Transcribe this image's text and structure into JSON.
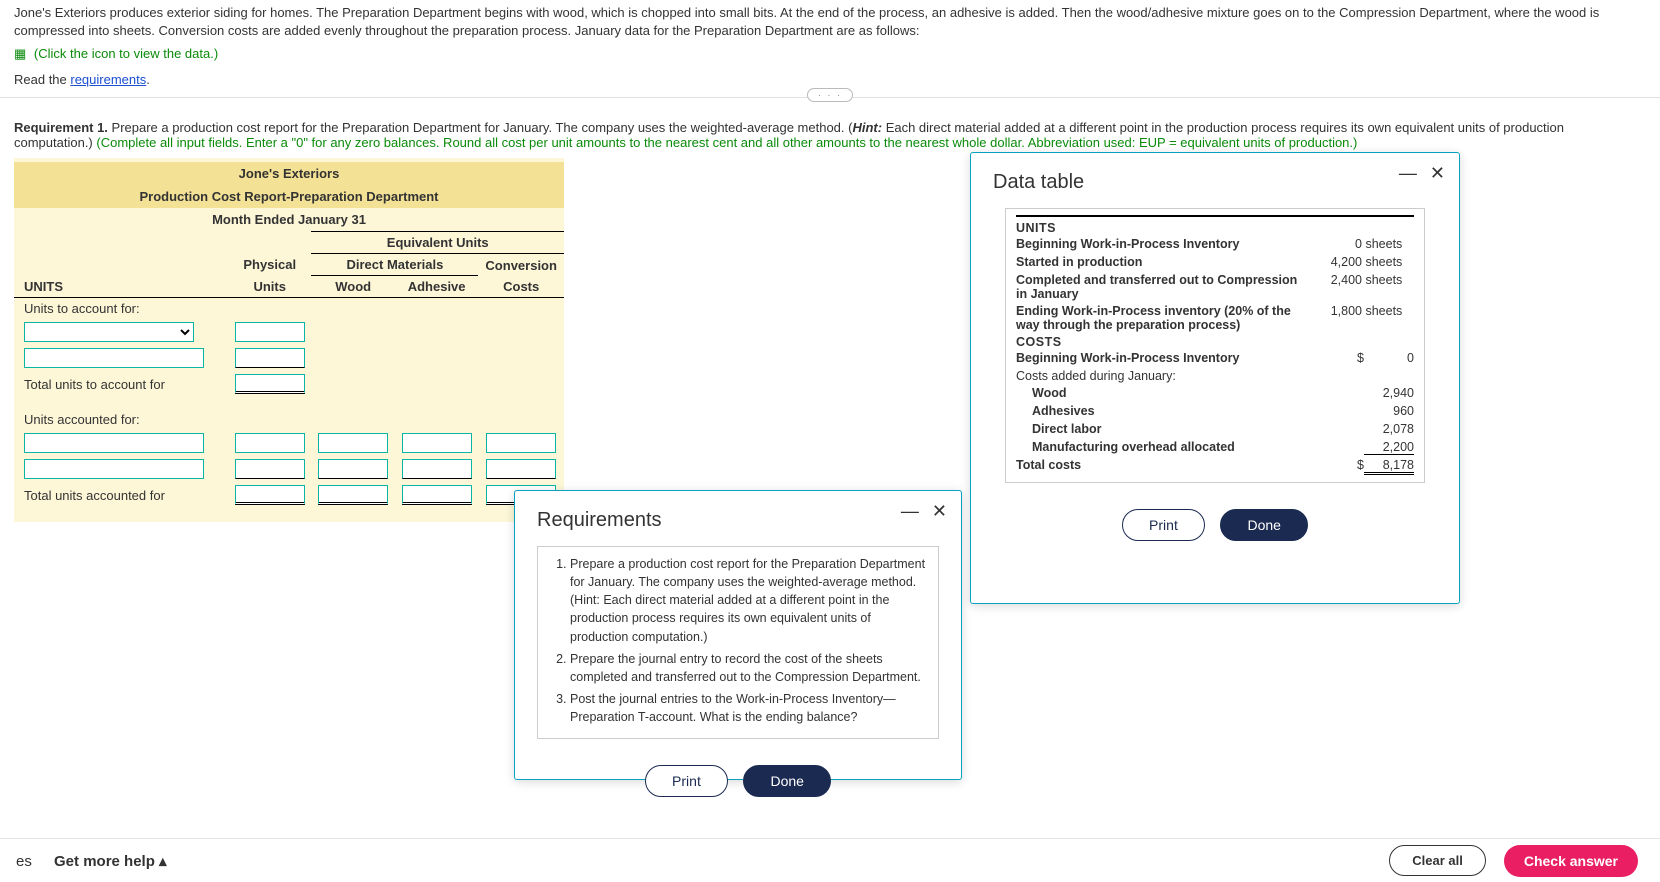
{
  "problem": {
    "paragraph": "Jone's Exteriors produces exterior siding for homes. The Preparation Department begins with wood, which is chopped into small bits. At the end of the process, an adhesive is added. Then the wood/adhesive mixture goes on to the Compression Department, where the wood is compressed into sheets. Conversion costs are added evenly throughout the preparation process. January data for the Preparation Department are as follows:",
    "view_data": "(Click the icon to view the data.)",
    "read_req_prefix": "Read the ",
    "read_req_link": "requirements",
    "read_req_suffix": "."
  },
  "separator_dots": "· · ·",
  "req1": {
    "label": "Requirement 1.",
    "text": " Prepare a production cost report for the Preparation Department for January. The company uses the weighted-average method. (",
    "hint_lbl": "Hint:",
    "hint_text": " Each direct material added at a different point in the production process requires its own equivalent units of production computation.) ",
    "complete": "(Complete all input fields. Enter a \"0\" for any zero balances. Round all cost per unit amounts to the nearest cent and all other amounts to the nearest whole dollar. Abbreviation used: EUP = equivalent units of production.)"
  },
  "worksheet": {
    "company": "Jone's Exteriors",
    "report": "Production Cost Report-Preparation Department",
    "period": "Month Ended January 31",
    "eq_units": "Equivalent Units",
    "physical": "Physical",
    "units_h": "Units",
    "dm": "Direct Materials",
    "wood": "Wood",
    "adhesive": "Adhesive",
    "conversion": "Conversion",
    "costs": "Costs",
    "units_section": "UNITS",
    "to_account": "Units to account for:",
    "total_to_account": "Total units to account for",
    "accounted_for": "Units accounted for:",
    "total_accounted": "Total units accounted for"
  },
  "requirements_modal": {
    "title": "Requirements",
    "items": [
      "Prepare a production cost report for the Preparation Department for January. The company uses the weighted-average method. (Hint: Each direct material added at a different point in the production process requires its own equivalent units of production computation.)",
      "Prepare the journal entry to record the cost of the sheets completed and transferred out to the Compression Department.",
      "Post the journal entries to the Work-in-Process Inventory—Preparation T-account. What is the ending balance?"
    ],
    "print": "Print",
    "done": "Done"
  },
  "data_modal": {
    "title": "Data table",
    "units_head": "UNITS",
    "rows_units": [
      {
        "lbl": "Beginning Work-in-Process Inventory",
        "val": "0",
        "unit": "sheets"
      },
      {
        "lbl": "Started in production",
        "val": "4,200",
        "unit": "sheets"
      },
      {
        "lbl": "Completed and transferred out to Compression in January",
        "val": "2,400",
        "unit": "sheets"
      },
      {
        "lbl": "Ending Work-in-Process inventory (20% of the way through the preparation process)",
        "val": "1,800",
        "unit": "sheets"
      }
    ],
    "costs_head": "COSTS",
    "bwip_lbl": "Beginning Work-in-Process Inventory",
    "bwip_cur": "$",
    "bwip_val": "0",
    "added_lbl": "Costs added during January:",
    "cost_rows": [
      {
        "lbl": "Wood",
        "val": "2,940"
      },
      {
        "lbl": "Adhesives",
        "val": "960"
      },
      {
        "lbl": "Direct labor",
        "val": "2,078"
      },
      {
        "lbl": "Manufacturing overhead allocated",
        "val": "2,200"
      }
    ],
    "total_lbl": "Total costs",
    "total_cur": "$",
    "total_val": "8,178",
    "print": "Print",
    "done": "Done"
  },
  "footer": {
    "es": "es",
    "help": "Get more help",
    "clear": "Clear all",
    "check": "Check answer"
  }
}
